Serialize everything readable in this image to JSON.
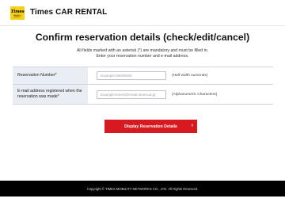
{
  "header": {
    "logo_text": "Times",
    "logo_subtext": "PARKING & MOBILITY",
    "brand": "Times CAR RENTAL"
  },
  "main": {
    "title": "Confirm reservation details (check/edit/cancel)",
    "intro_before_asterisk": "All fields marked with an asterisk (",
    "intro_asterisk": "*",
    "intro_after_asterisk": ") are mandatory and must be filled in.",
    "intro_line2": "Enter your reservation number and e-mail address."
  },
  "form": {
    "rows": [
      {
        "label": "Reservation Number*",
        "placeholder": "Example:00000000",
        "hint": "(Half width numerals)"
      },
      {
        "label": "E-mail address registered when the reservation was made*",
        "placeholder": "Example:times@rental.timescar.jp",
        "hint": "(Alphanumeric Characters)"
      }
    ],
    "submit_label": "Display Reservation Details",
    "submit_icon": "chevron-right-icon"
  },
  "footer": {
    "copyright": "Copyright © TIMES MOBILITY NETWORKS CO., LTD. All Rights Reserved."
  },
  "colors": {
    "accent": "#d71920",
    "brand_yellow": "#f7d117",
    "label_bg": "#e8eef4",
    "footer_bg": "#000000"
  }
}
